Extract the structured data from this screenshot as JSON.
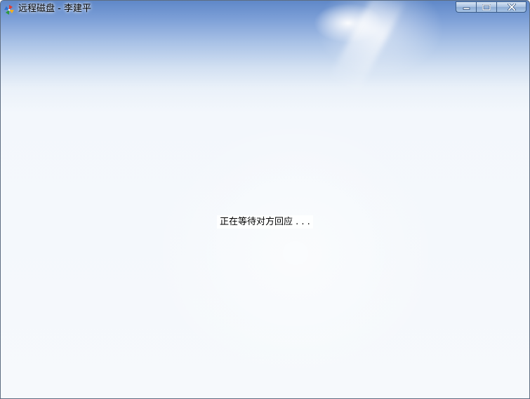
{
  "window": {
    "title": "远程磁盘 - 李建平",
    "app_icon": "multicolor-pinwheel-icon",
    "controls": {
      "minimize_icon": "minimize-icon",
      "maximize_icon": "maximize-icon",
      "close_icon": "close-icon"
    }
  },
  "content": {
    "status_text": "正在等待对方回应 . . ."
  },
  "colors": {
    "title_gradient_top": "#5f88c8",
    "content_background": "#f6f9fc",
    "window_border": "#5d6d82"
  }
}
